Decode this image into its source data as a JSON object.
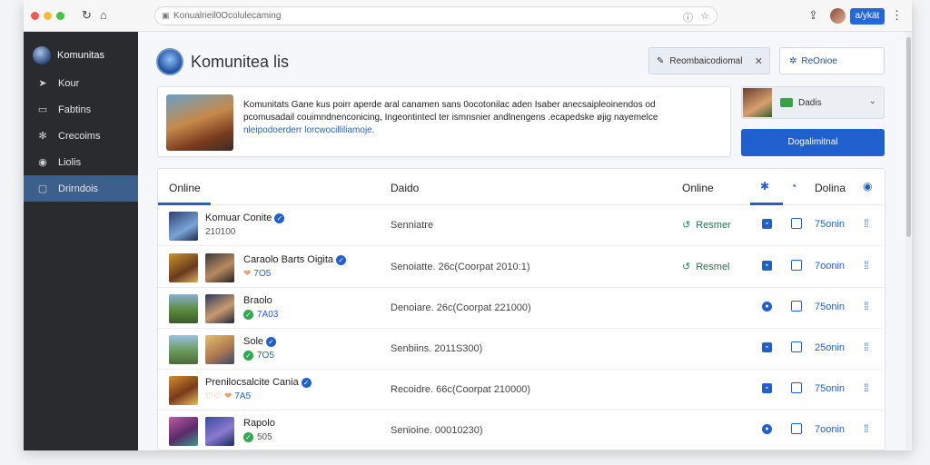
{
  "browser": {
    "url": "Konualrieil0Ocolulecaming",
    "ext_button": "a/ykät"
  },
  "sidebar": {
    "profile_name": "Komunitas",
    "items": [
      {
        "label": "Kour",
        "icon": "pin-icon"
      },
      {
        "label": "Fabtins",
        "icon": "window-icon"
      },
      {
        "label": "Crecoims",
        "icon": "gear-icon"
      },
      {
        "label": "Liolis",
        "icon": "circle-icon"
      },
      {
        "label": "Drirndois",
        "icon": "card-icon",
        "active": true
      }
    ]
  },
  "header": {
    "title": "Komunitea lis",
    "chip_label": "Reombaicodiomal",
    "outline_button": "ReOnioe"
  },
  "info_card": {
    "line1": "Komunitats Gane kus poirr aperde aral canamen sans 0ocotonilac aden Isaber anecsaipleoinendos od",
    "line2": "pcomusadail couimndnenconicing, Ingeontintecl ter ismnsnier andlnengens .ecapedske øjig nayemelce",
    "line3_link": "nleipodoerderr lorcwocilliliamoje."
  },
  "side_card": {
    "label": "Dadis",
    "primary_button": "Dogalimitnal"
  },
  "table": {
    "headers": {
      "col1": "Online",
      "col2": "Daido",
      "col3": "Online",
      "col4": "Dolina"
    },
    "rows": [
      {
        "name": "Komuar Conite",
        "sub": "210100",
        "desc": "Senniatre",
        "status": "Resmer",
        "time": "75onin",
        "thumbs": 1
      },
      {
        "name": "Caraolo Barts Oigita",
        "sub": "7O5",
        "desc": "Senoiatte. 26c(Coorpat 2010:1)",
        "status": "Resmel",
        "time": "7oonin",
        "thumbs": 2
      },
      {
        "name": "Braolo",
        "sub": "7A03",
        "desc": "Denoiare. 26c(Coorpat 221000)",
        "status": "",
        "time": "75onin",
        "thumbs": 2
      },
      {
        "name": "Sole",
        "sub": "7O5",
        "desc": "Senbiins. 2011S300)",
        "status": "",
        "time": "25onin",
        "thumbs": 2
      },
      {
        "name": "Prenilocsalcite Cania",
        "sub": "7A5",
        "desc": "Recoidre. 66c(Coorpat 210000)",
        "status": "",
        "time": "75onin",
        "thumbs": 1
      },
      {
        "name": "Rapolo",
        "sub": "505",
        "desc": "Senioine. 00010230)",
        "status": "",
        "time": "7oonin",
        "thumbs": 2
      }
    ]
  },
  "colors": {
    "accent": "#1f5fce",
    "sidebar_bg": "#2a2b2e",
    "active_item": "#3d5f8c",
    "status_green": "#2fa84f"
  }
}
